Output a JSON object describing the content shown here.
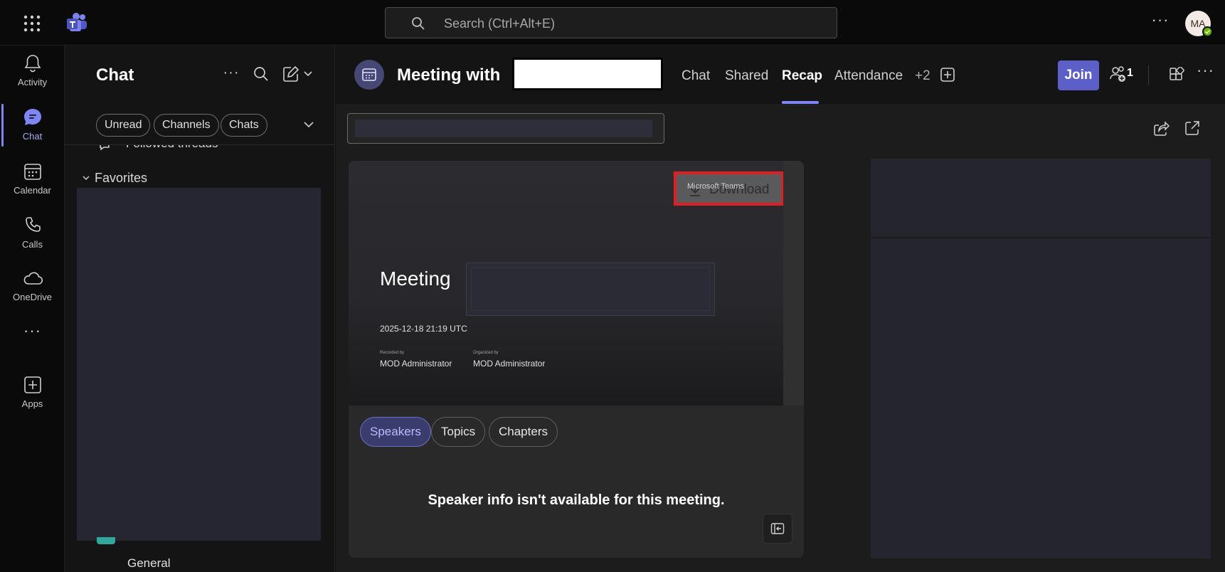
{
  "search": {
    "placeholder": "Search (Ctrl+Alt+E)"
  },
  "user": {
    "initials": "MA",
    "presence": "available"
  },
  "rail": {
    "items": [
      {
        "label": "Activity",
        "icon": "bell-icon"
      },
      {
        "label": "Chat",
        "icon": "chat-icon",
        "active": true
      },
      {
        "label": "Calendar",
        "icon": "calendar-icon"
      },
      {
        "label": "Calls",
        "icon": "phone-icon"
      },
      {
        "label": "OneDrive",
        "icon": "cloud-icon"
      },
      {
        "label": "",
        "icon": "more-apps-icon"
      },
      {
        "label": "Apps",
        "icon": "add-app-icon"
      }
    ]
  },
  "chat_pane": {
    "title": "Chat",
    "filters": [
      "Unread",
      "Channels",
      "Chats"
    ],
    "followed_threads": "Followed threads",
    "favorites_label": "Favorites",
    "channel_item": "General"
  },
  "meeting": {
    "title": "Meeting with",
    "tabs": [
      "Chat",
      "Shared",
      "Recap",
      "Attendance",
      "+2"
    ],
    "active_tab": "Recap",
    "join_label": "Join",
    "participant_count": "1"
  },
  "recap": {
    "video": {
      "brand": "Microsoft Teams",
      "download_label": "Download",
      "title": "Meeting",
      "date": "2025-12-18 21:19 UTC",
      "recorded_by_label": "Recorded by",
      "recorded_by": "MOD Administrator",
      "organized_by_label": "Organized by",
      "organized_by": "MOD Administrator"
    },
    "chips": [
      "Speakers",
      "Topics",
      "Chapters"
    ],
    "active_chip": "Speakers",
    "speaker_message": "Speaker info isn't available for this meeting."
  },
  "colors": {
    "accent": "#7f85f5",
    "join": "#5b5fc7",
    "highlight_box": "#e01e24"
  }
}
